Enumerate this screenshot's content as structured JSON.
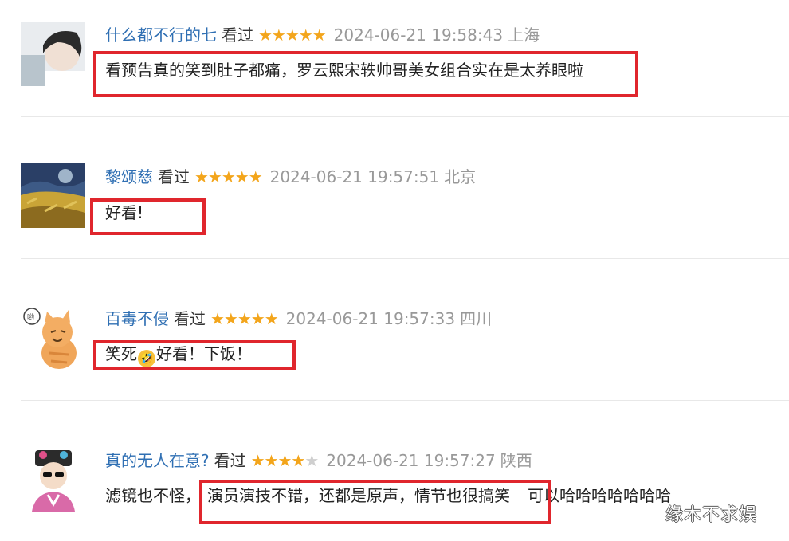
{
  "comments": [
    {
      "user": "什么都不行的七",
      "status": "看过",
      "rating": 5,
      "time": "2024-06-21 19:58:43",
      "location": "上海",
      "text": "看预告真的笑到肚子都痛，罗云熙宋轶帅哥美女组合实在是太养眼啦"
    },
    {
      "user": "黎颂慈",
      "status": "看过",
      "rating": 5,
      "time": "2024-06-21 19:57:51",
      "location": "北京",
      "text": "好看!"
    },
    {
      "user": "百毒不侵",
      "status": "看过",
      "rating": 5,
      "time": "2024-06-21 19:57:33",
      "location": "四川",
      "text_before": "笑死",
      "emoji": "🤣",
      "text_after": "好看！下饭！"
    },
    {
      "user": "真的无人在意?",
      "status": "看过",
      "rating": 4,
      "time": "2024-06-21 19:57:27",
      "location": "陕西",
      "text_a": "滤镜也不怪，",
      "text_b": "演员演技不错，还都是原声，情节也很搞笑",
      "text_c": "可以哈哈哈哈哈哈哈"
    }
  ],
  "watermark": "缘木不求娱",
  "colors": {
    "username": "#2f6fb3",
    "star": "#f3a51b",
    "star_empty": "#cfcfcf",
    "meta_gray": "#999999",
    "highlight_border": "#e0262d"
  }
}
